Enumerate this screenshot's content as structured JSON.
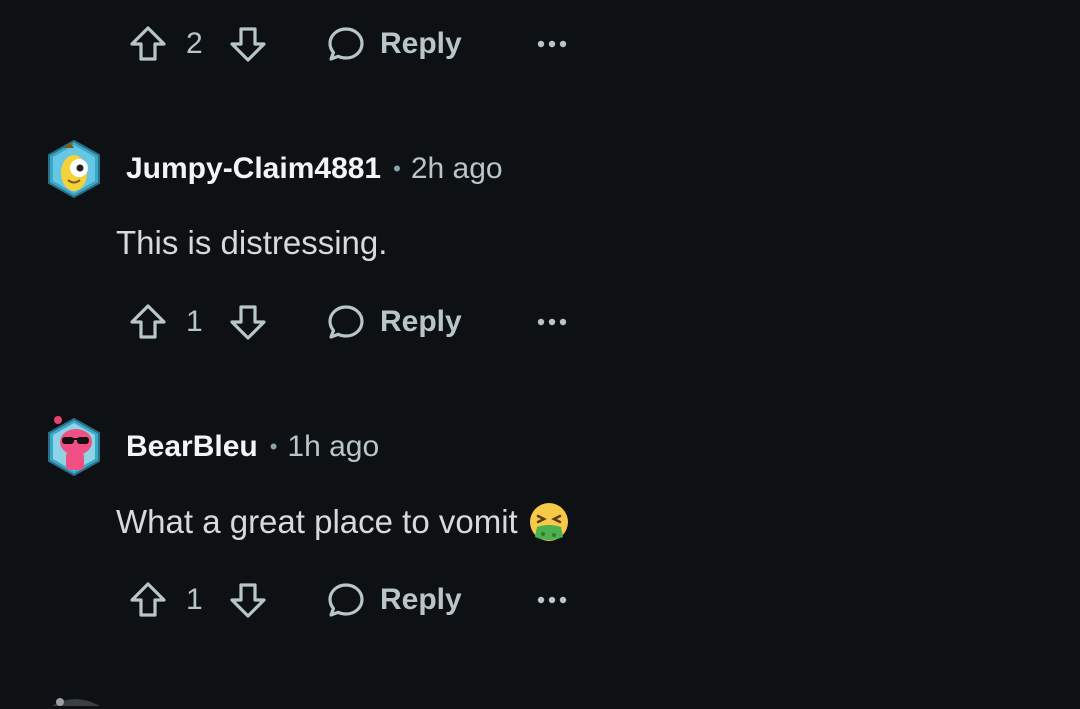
{
  "comments": [
    {
      "score": "2",
      "reply_label": "Reply"
    },
    {
      "username": "Jumpy-Claim4881",
      "separator": "•",
      "time": "2h ago",
      "body": "This is distressing.",
      "score": "1",
      "reply_label": "Reply",
      "avatar_icon": "banana-snoo-avatar-icon"
    },
    {
      "username": "BearBleu",
      "separator": "•",
      "time": "1h ago",
      "body": "What a great place to vomit",
      "emoji": "vomiting-face-emoji",
      "score": "1",
      "reply_label": "Reply",
      "avatar_icon": "pink-snoo-sunglasses-avatar-icon"
    }
  ],
  "icons": {
    "upvote": "arrow-up-outline-icon",
    "downvote": "arrow-down-outline-icon",
    "reply": "speech-bubble-icon",
    "more": "ellipsis-icon"
  },
  "colors": {
    "background": "#0e1113",
    "text_primary": "#f2f4f5",
    "text_secondary": "#b8c5c9",
    "body_text": "#d7dadc"
  }
}
